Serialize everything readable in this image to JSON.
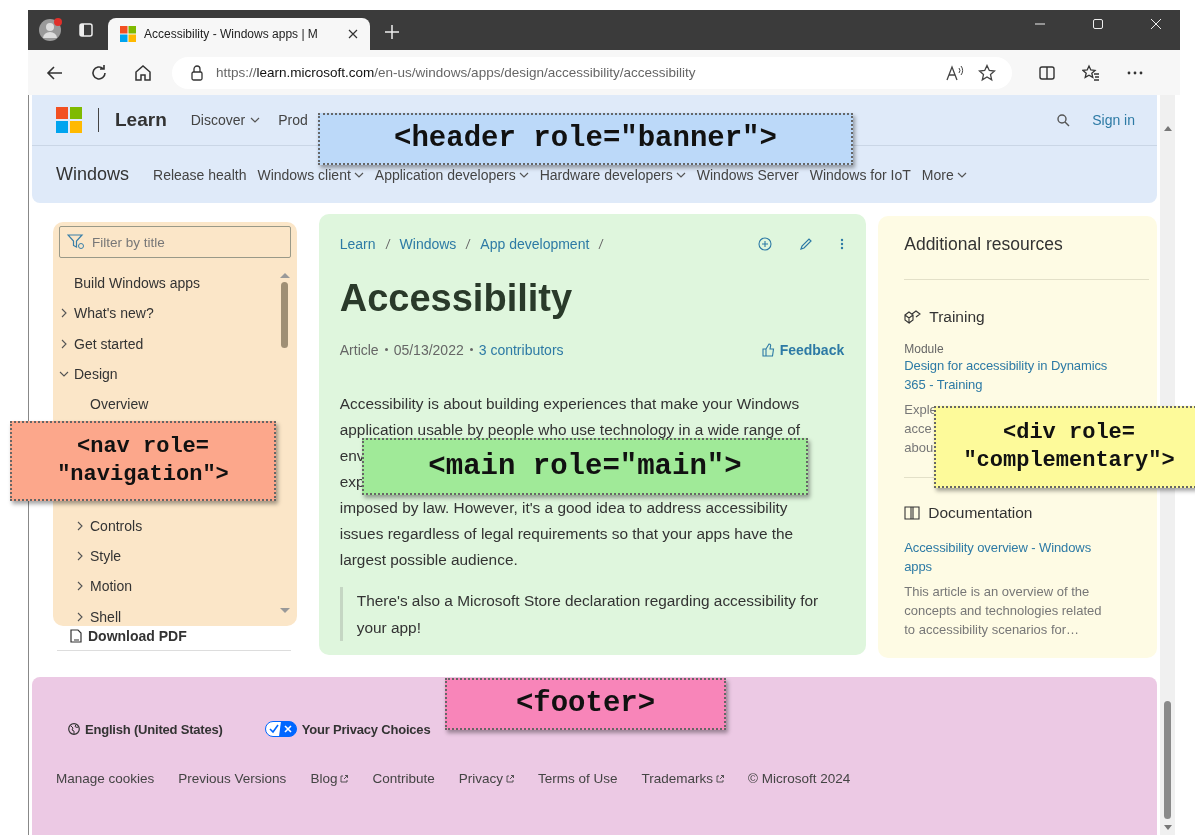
{
  "browser": {
    "tab_title": "Accessibility - Windows apps | M",
    "url_scheme": "https://",
    "url_host": "learn.microsoft.com",
    "url_path": "/en-us/windows/apps/design/accessibility/accessibility"
  },
  "header": {
    "brand": "Learn",
    "nav": [
      {
        "label": "Discover",
        "dropdown": true
      },
      {
        "label": "Prod",
        "dropdown": false
      }
    ],
    "sign_in": "Sign in",
    "product": "Windows",
    "subnav": [
      {
        "label": "Release health",
        "dropdown": false
      },
      {
        "label": "Windows client",
        "dropdown": true
      },
      {
        "label": "Application developers",
        "dropdown": true
      },
      {
        "label": "Hardware developers",
        "dropdown": true
      },
      {
        "label": "Windows Server",
        "dropdown": false
      },
      {
        "label": "Windows for IoT",
        "dropdown": false
      },
      {
        "label": "More",
        "dropdown": true
      }
    ]
  },
  "nav": {
    "filter_placeholder": "Filter by title",
    "items": [
      {
        "label": "Build Windows apps"
      },
      {
        "label": "What's new?",
        "expanded": false
      },
      {
        "label": "Get started",
        "expanded": false
      },
      {
        "label": "Design",
        "expanded": true,
        "children": [
          {
            "label": "Overview"
          },
          {
            "label": "Controls",
            "expanded": false
          },
          {
            "label": "Style",
            "expanded": false
          },
          {
            "label": "Motion",
            "expanded": false
          },
          {
            "label": "Shell",
            "expanded": false
          }
        ]
      }
    ],
    "download": "Download PDF"
  },
  "main": {
    "breadcrumbs": [
      "Learn",
      "Windows",
      "App development"
    ],
    "title": "Accessibility",
    "meta": {
      "type": "Article",
      "date": "05/13/2022",
      "contributors": "3 contributors"
    },
    "feedback": "Feedback",
    "paragraph_lines": [
      "Accessibility is about building experiences that make your Windows",
      "application usable by people who use technology in a wide range of",
      "env",
      "exp",
      "imposed by law. However, it's a good idea to address accessibility",
      "issues regardless of legal requirements so that your apps have the",
      "largest possible audience."
    ],
    "note": "There's also a Microsoft Store declaration regarding accessibility for your app!"
  },
  "aside": {
    "title": "Additional resources",
    "sections": [
      {
        "kind": "training",
        "heading": "Training",
        "type": "Module",
        "link": "Design for accessibility in Dynamics 365 - Training",
        "description_lines": [
          "Exple",
          "acce",
          "abou"
        ]
      },
      {
        "kind": "documentation",
        "heading": "Documentation",
        "link": "Accessibility overview - Windows apps",
        "description_lines": [
          "This article is an overview of the",
          "concepts and technologies related",
          "to accessibility scenarios for…"
        ]
      }
    ]
  },
  "footer": {
    "locale": "English (United States)",
    "privacy": "Your Privacy Choices",
    "links": [
      {
        "label": "Manage cookies",
        "external": false
      },
      {
        "label": "Previous Versions",
        "external": false
      },
      {
        "label": "Blog",
        "external": true
      },
      {
        "label": "Contribute",
        "external": false
      },
      {
        "label": "Privacy",
        "external": true
      },
      {
        "label": "Terms of Use",
        "external": false
      },
      {
        "label": "Trademarks",
        "external": true
      },
      {
        "label": "© Microsoft 2024",
        "external": false
      }
    ]
  },
  "annotations": [
    {
      "kind": "header",
      "color": "#bcd9f9",
      "lines": [
        "<header role=\"banner\">"
      ]
    },
    {
      "kind": "nav",
      "color": "#fca78b",
      "lines": [
        "<nav role=",
        "\"navigation\">"
      ]
    },
    {
      "kind": "main",
      "color": "#a0ea98",
      "lines": [
        "<main role=\"main\">"
      ]
    },
    {
      "kind": "aside",
      "color": "#fdfa9a",
      "lines": [
        "<div role=",
        "\"complementary\">"
      ]
    },
    {
      "kind": "footer",
      "color": "#f885b9",
      "lines": [
        "<footer>"
      ]
    }
  ]
}
